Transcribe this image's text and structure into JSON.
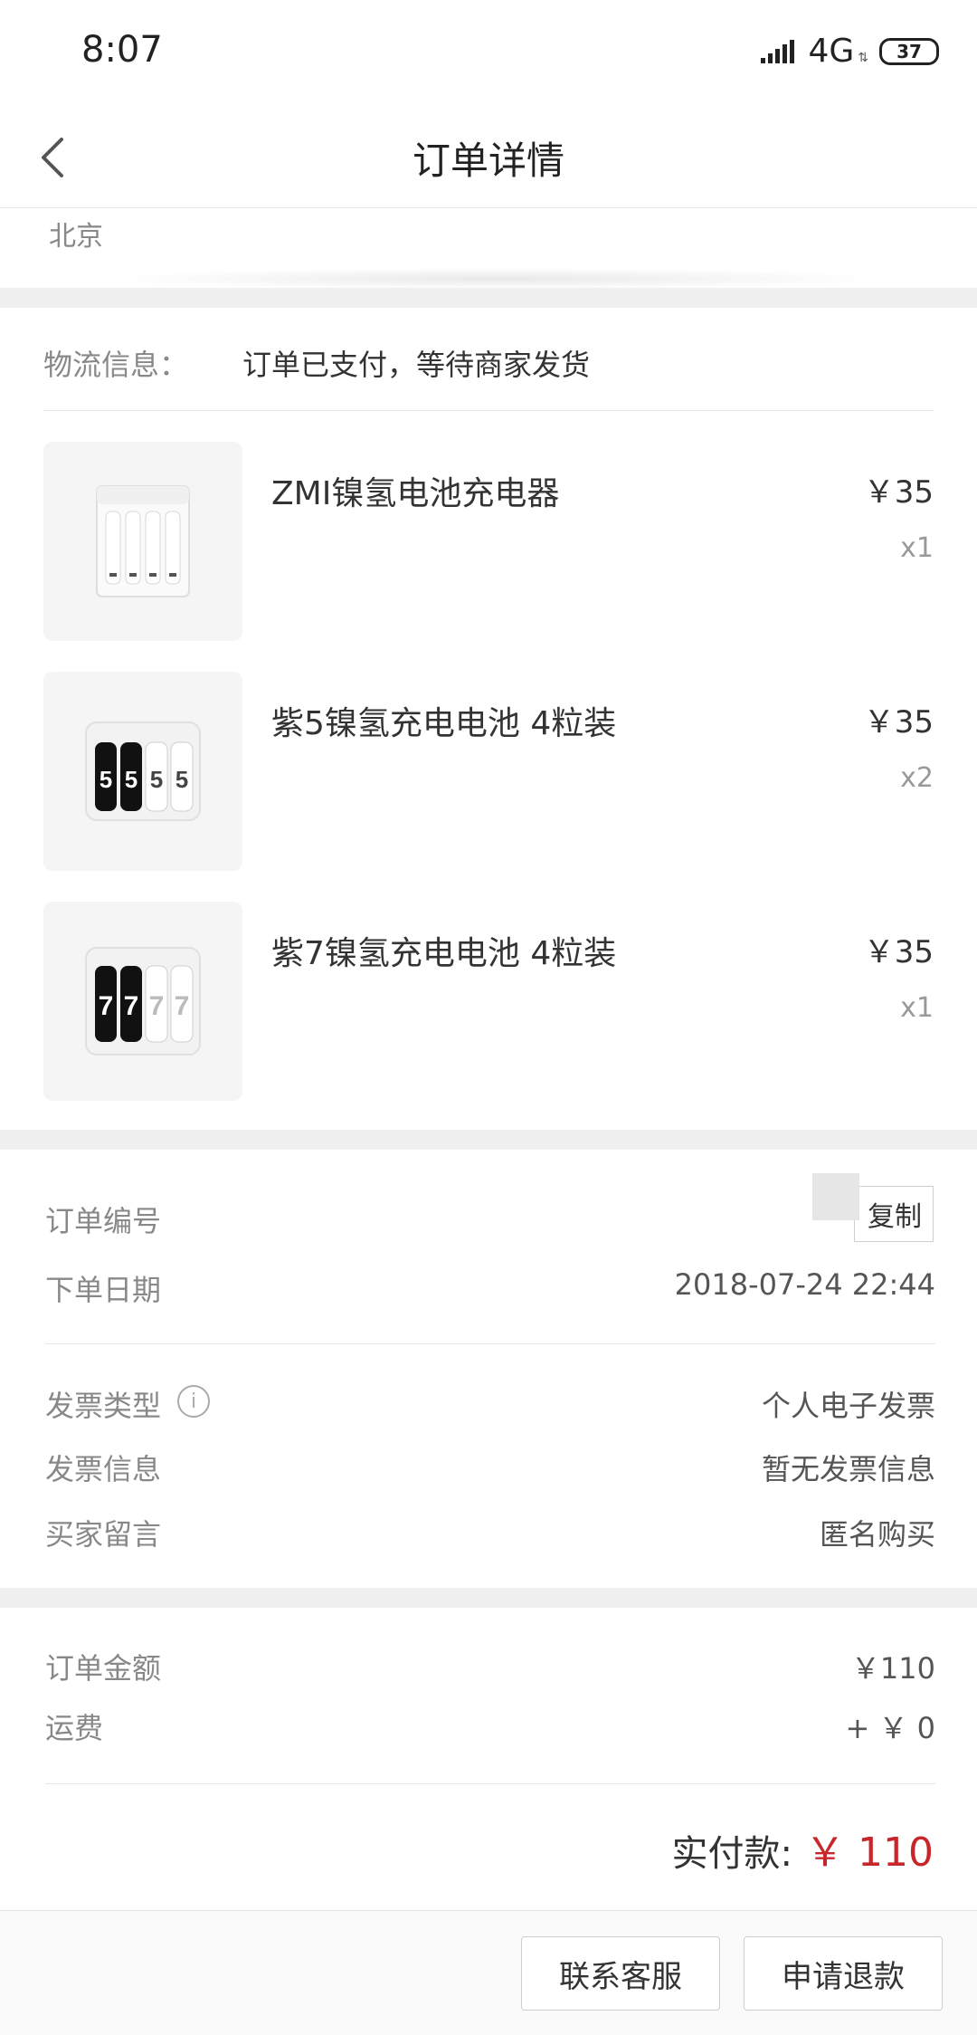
{
  "status_bar": {
    "time": "8:07",
    "network": "4G",
    "battery": "37"
  },
  "header": {
    "title": "订单详情"
  },
  "address": {
    "city": "北京"
  },
  "logistics": {
    "label": "物流信息：",
    "value": "订单已支付，等待商家发货"
  },
  "products": [
    {
      "name": "ZMI镍氢电池充电器",
      "price": "￥35",
      "qty": "x1",
      "thumb_icon": "battery-charger-icon"
    },
    {
      "name": "紫5镍氢充电电池 4粒装",
      "price": "￥35",
      "qty": "x2",
      "thumb_icon": "aa-battery-pack-icon"
    },
    {
      "name": "紫7镍氢充电电池 4粒装",
      "price": "￥35",
      "qty": "x1",
      "thumb_icon": "aaa-battery-pack-icon"
    }
  ],
  "order_info": {
    "order_no_label": "订单编号",
    "copy_label": "复制",
    "date_label": "下单日期",
    "date_value": "2018-07-24 22:44",
    "invoice_type_label": "发票类型",
    "invoice_type_value": "个人电子发票",
    "invoice_info_label": "发票信息",
    "invoice_info_value": "暂无发票信息",
    "buyer_note_label": "买家留言",
    "buyer_note_value": "匿名购买"
  },
  "amounts": {
    "order_amount_label": "订单金额",
    "order_amount_value": "￥110",
    "shipping_label": "运费",
    "shipping_value": "+ ￥ 0",
    "paid_label": "实付款:",
    "paid_value": "￥ 110"
  },
  "actions": {
    "contact_label": "联系客服",
    "refund_label": "申请退款"
  },
  "colors": {
    "accent": "#c8262a",
    "divider": "#f0f0f0"
  }
}
